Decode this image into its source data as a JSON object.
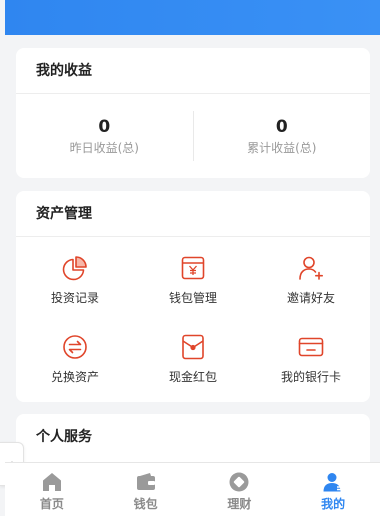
{
  "colors": {
    "accent": "#2f86f0",
    "icon": "#e0452a",
    "tab_inactive": "#9a9a9a"
  },
  "earnings": {
    "title": "我的收益",
    "yesterday": {
      "value": "0",
      "label": "昨日收益(总)"
    },
    "total": {
      "value": "0",
      "label": "累计收益(总)"
    }
  },
  "assets": {
    "title": "资产管理",
    "items": [
      {
        "label": "投资记录",
        "icon": "pie-chart-icon"
      },
      {
        "label": "钱包管理",
        "icon": "wallet-yen-icon"
      },
      {
        "label": "邀请好友",
        "icon": "add-user-icon"
      },
      {
        "label": "兑换资产",
        "icon": "exchange-icon"
      },
      {
        "label": "现金红包",
        "icon": "red-envelope-icon"
      },
      {
        "label": "我的银行卡",
        "icon": "bank-card-icon"
      }
    ]
  },
  "services": {
    "title": "个人服务"
  },
  "tabbar": {
    "items": [
      {
        "label": "首页",
        "icon": "home-icon"
      },
      {
        "label": "钱包",
        "icon": "wallet-icon"
      },
      {
        "label": "理财",
        "icon": "finance-icon"
      },
      {
        "label": "我的",
        "icon": "profile-icon",
        "active": true
      }
    ]
  }
}
